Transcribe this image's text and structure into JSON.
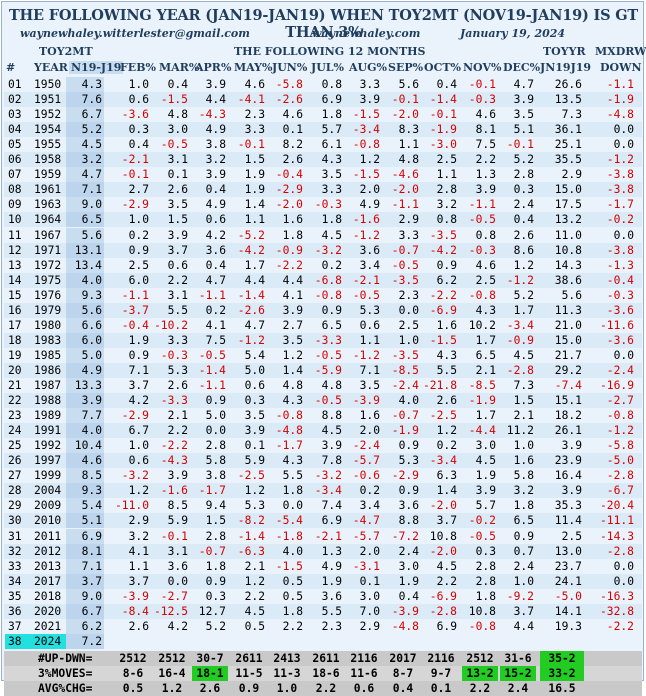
{
  "title": "THE FOLLOWING YEAR (JAN19-JAN19) WHEN TOY2MT (NOV19-JAN19) IS GT THAN 3%",
  "email": "waynewhaley.witterlester@gmail.com",
  "site": "waynewhaley.com",
  "date": "January 19, 2024",
  "group_toy2mt": "TOY2MT",
  "group_following": "THE FOLLOWING 12 MONTHS",
  "group_toyyr": "TOYYR",
  "group_mxdrw": "MXDRW",
  "columns": [
    "#",
    "YEAR",
    "N19-J19",
    "FEB%",
    "MAR%",
    "APR%",
    "MAY%",
    "JUN%",
    "JUL%",
    "AUG%",
    "SEP%",
    "OCT%",
    "NOV%",
    "DEC%",
    "JN19J19",
    "DOWN"
  ],
  "rows": [
    [
      "01",
      "1950",
      "4.3",
      "1.0",
      "0.4",
      "3.9",
      "4.6",
      "-5.8",
      "0.8",
      "3.3",
      "5.6",
      "0.4",
      "-0.1",
      "4.7",
      "26.6",
      "-1.1"
    ],
    [
      "02",
      "1951",
      "7.6",
      "0.6",
      "-1.5",
      "4.4",
      "-4.1",
      "-2.6",
      "6.9",
      "3.9",
      "-0.1",
      "-1.4",
      "-0.3",
      "3.9",
      "13.5",
      "-1.9"
    ],
    [
      "03",
      "1952",
      "6.7",
      "-3.6",
      "4.8",
      "-4.3",
      "2.3",
      "4.6",
      "1.8",
      "-1.5",
      "-2.0",
      "-0.1",
      "4.6",
      "3.5",
      "7.3",
      "-4.8"
    ],
    [
      "04",
      "1954",
      "5.2",
      "0.3",
      "3.0",
      "4.9",
      "3.3",
      "0.1",
      "5.7",
      "-3.4",
      "8.3",
      "-1.9",
      "8.1",
      "5.1",
      "36.1",
      "0.0"
    ],
    [
      "05",
      "1955",
      "4.5",
      "0.4",
      "-0.5",
      "3.8",
      "-0.1",
      "8.2",
      "6.1",
      "-0.8",
      "1.1",
      "-3.0",
      "7.5",
      "-0.1",
      "25.1",
      "0.0"
    ],
    [
      "06",
      "1958",
      "3.2",
      "-2.1",
      "3.1",
      "3.2",
      "1.5",
      "2.6",
      "4.3",
      "1.2",
      "4.8",
      "2.5",
      "2.2",
      "5.2",
      "35.5",
      "-1.2"
    ],
    [
      "07",
      "1959",
      "4.7",
      "-0.1",
      "0.1",
      "3.9",
      "1.9",
      "-0.4",
      "3.5",
      "-1.5",
      "-4.6",
      "1.1",
      "1.3",
      "2.8",
      "2.9",
      "-3.8"
    ],
    [
      "08",
      "1961",
      "7.1",
      "2.7",
      "2.6",
      "0.4",
      "1.9",
      "-2.9",
      "3.3",
      "2.0",
      "-2.0",
      "2.8",
      "3.9",
      "0.3",
      "15.0",
      "-3.8"
    ],
    [
      "09",
      "1963",
      "9.0",
      "-2.9",
      "3.5",
      "4.9",
      "1.4",
      "-2.0",
      "-0.3",
      "4.9",
      "-1.1",
      "3.2",
      "-1.1",
      "2.4",
      "17.5",
      "-1.7"
    ],
    [
      "10",
      "1964",
      "6.5",
      "1.0",
      "1.5",
      "0.6",
      "1.1",
      "1.6",
      "1.8",
      "-1.6",
      "2.9",
      "0.8",
      "-0.5",
      "0.4",
      "13.2",
      "-0.2"
    ],
    [
      "11",
      "1967",
      "5.6",
      "0.2",
      "3.9",
      "4.2",
      "-5.2",
      "1.8",
      "4.5",
      "-1.2",
      "3.3",
      "-3.5",
      "0.8",
      "2.6",
      "11.0",
      "0.0"
    ],
    [
      "12",
      "1971",
      "13.1",
      "0.9",
      "3.7",
      "3.6",
      "-4.2",
      "-0.9",
      "-3.2",
      "3.6",
      "-0.7",
      "-4.2",
      "-0.3",
      "8.6",
      "10.8",
      "-3.8"
    ],
    [
      "13",
      "1972",
      "13.4",
      "2.5",
      "0.6",
      "0.4",
      "1.7",
      "-2.2",
      "0.2",
      "3.4",
      "-0.5",
      "0.9",
      "4.6",
      "1.2",
      "14.3",
      "-1.3"
    ],
    [
      "14",
      "1975",
      "4.0",
      "6.0",
      "2.2",
      "4.7",
      "4.4",
      "4.4",
      "-6.8",
      "-2.1",
      "-3.5",
      "6.2",
      "2.5",
      "-1.2",
      "38.6",
      "-0.4"
    ],
    [
      "15",
      "1976",
      "9.3",
      "-1.1",
      "3.1",
      "-1.1",
      "-1.4",
      "4.1",
      "-0.8",
      "-0.5",
      "2.3",
      "-2.2",
      "-0.8",
      "5.2",
      "5.6",
      "-0.3"
    ],
    [
      "16",
      "1979",
      "5.6",
      "-3.7",
      "5.5",
      "0.2",
      "-2.6",
      "3.9",
      "0.9",
      "5.3",
      "0.0",
      "-6.9",
      "4.3",
      "1.7",
      "11.3",
      "-3.6"
    ],
    [
      "17",
      "1980",
      "6.6",
      "-0.4",
      "-10.2",
      "4.1",
      "4.7",
      "2.7",
      "6.5",
      "0.6",
      "2.5",
      "1.6",
      "10.2",
      "-3.4",
      "21.0",
      "-11.6"
    ],
    [
      "18",
      "1983",
      "6.0",
      "1.9",
      "3.3",
      "7.5",
      "-1.2",
      "3.5",
      "-3.3",
      "1.1",
      "1.0",
      "-1.5",
      "1.7",
      "-0.9",
      "15.0",
      "-3.6"
    ],
    [
      "19",
      "1985",
      "5.0",
      "0.9",
      "-0.3",
      "-0.5",
      "5.4",
      "1.2",
      "-0.5",
      "-1.2",
      "-3.5",
      "4.3",
      "6.5",
      "4.5",
      "21.7",
      "0.0"
    ],
    [
      "20",
      "1986",
      "4.9",
      "7.1",
      "5.3",
      "-1.4",
      "5.0",
      "1.4",
      "-5.9",
      "7.1",
      "-8.5",
      "5.5",
      "2.1",
      "-2.8",
      "29.2",
      "-2.4"
    ],
    [
      "21",
      "1987",
      "13.3",
      "3.7",
      "2.6",
      "-1.1",
      "0.6",
      "4.8",
      "4.8",
      "3.5",
      "-2.4",
      "-21.8",
      "-8.5",
      "7.3",
      "-7.4",
      "-16.9"
    ],
    [
      "22",
      "1988",
      "3.9",
      "4.2",
      "-3.3",
      "0.9",
      "0.3",
      "4.3",
      "-0.5",
      "-3.9",
      "4.0",
      "2.6",
      "-1.9",
      "1.5",
      "15.1",
      "-2.7"
    ],
    [
      "23",
      "1989",
      "7.7",
      "-2.9",
      "2.1",
      "5.0",
      "3.5",
      "-0.8",
      "8.8",
      "1.6",
      "-0.7",
      "-2.5",
      "1.7",
      "2.1",
      "18.2",
      "-0.8"
    ],
    [
      "24",
      "1991",
      "4.0",
      "6.7",
      "2.2",
      "0.0",
      "3.9",
      "-4.8",
      "4.5",
      "2.0",
      "-1.9",
      "1.2",
      "-4.4",
      "11.2",
      "26.1",
      "-1.2"
    ],
    [
      "25",
      "1992",
      "10.4",
      "1.0",
      "-2.2",
      "2.8",
      "0.1",
      "-1.7",
      "3.9",
      "-2.4",
      "0.9",
      "0.2",
      "3.0",
      "1.0",
      "3.9",
      "-5.8"
    ],
    [
      "26",
      "1997",
      "4.6",
      "0.6",
      "-4.3",
      "5.8",
      "5.9",
      "4.3",
      "7.8",
      "-5.7",
      "5.3",
      "-3.4",
      "4.5",
      "1.6",
      "23.9",
      "-5.0"
    ],
    [
      "27",
      "1999",
      "8.5",
      "-3.2",
      "3.9",
      "3.8",
      "-2.5",
      "5.5",
      "-3.2",
      "-0.6",
      "-2.9",
      "6.3",
      "1.9",
      "5.8",
      "16.4",
      "-2.8"
    ],
    [
      "28",
      "2004",
      "9.3",
      "1.2",
      "-1.6",
      "-1.7",
      "1.2",
      "1.8",
      "-3.4",
      "0.2",
      "0.9",
      "1.4",
      "3.9",
      "3.2",
      "3.9",
      "-6.7"
    ],
    [
      "29",
      "2009",
      "5.4",
      "-11.0",
      "8.5",
      "9.4",
      "5.3",
      "0.0",
      "7.4",
      "3.4",
      "3.6",
      "-2.0",
      "5.7",
      "1.8",
      "35.3",
      "-20.4"
    ],
    [
      "30",
      "2010",
      "5.1",
      "2.9",
      "5.9",
      "1.5",
      "-8.2",
      "-5.4",
      "6.9",
      "-4.7",
      "8.8",
      "3.7",
      "-0.2",
      "6.5",
      "11.4",
      "-11.1"
    ],
    [
      "31",
      "2011",
      "6.9",
      "3.2",
      "-0.1",
      "2.8",
      "-1.4",
      "-1.8",
      "-2.1",
      "-5.7",
      "-7.2",
      "10.8",
      "-0.5",
      "0.9",
      "2.5",
      "-14.3"
    ],
    [
      "32",
      "2012",
      "8.1",
      "4.1",
      "3.1",
      "-0.7",
      "-6.3",
      "4.0",
      "1.3",
      "2.0",
      "2.4",
      "-2.0",
      "0.3",
      "0.7",
      "13.0",
      "-2.8"
    ],
    [
      "33",
      "2013",
      "7.1",
      "1.1",
      "3.6",
      "1.8",
      "2.1",
      "-1.5",
      "4.9",
      "-3.1",
      "3.0",
      "4.5",
      "2.8",
      "2.4",
      "23.7",
      "0.0"
    ],
    [
      "34",
      "2017",
      "3.7",
      "3.7",
      "0.0",
      "0.9",
      "1.2",
      "0.5",
      "1.9",
      "0.1",
      "1.9",
      "2.2",
      "2.8",
      "1.0",
      "24.1",
      "0.0"
    ],
    [
      "35",
      "2018",
      "9.0",
      "-3.9",
      "-2.7",
      "0.3",
      "2.2",
      "0.5",
      "3.6",
      "3.0",
      "0.4",
      "-6.9",
      "1.8",
      "-9.2",
      "-5.0",
      "-16.3"
    ],
    [
      "36",
      "2020",
      "6.7",
      "-8.4",
      "-12.5",
      "12.7",
      "4.5",
      "1.8",
      "5.5",
      "7.0",
      "-3.9",
      "-2.8",
      "10.8",
      "3.7",
      "14.1",
      "-32.8"
    ],
    [
      "37",
      "2021",
      "6.2",
      "2.6",
      "4.2",
      "5.2",
      "0.5",
      "2.2",
      "2.3",
      "2.9",
      "-4.8",
      "6.9",
      "-0.8",
      "4.4",
      "19.3",
      "-2.2"
    ],
    [
      "38",
      "2024",
      "7.2",
      "",
      "",
      "",
      "",
      "",
      "",
      "",
      "",
      "",
      "",
      "",
      "",
      ""
    ]
  ],
  "footer": {
    "up_label": "#UP-DWN=",
    "up": [
      "2512",
      "2512",
      "30-7",
      "2611",
      "2413",
      "2611",
      "2116",
      "2017",
      "2116",
      "2512",
      "31-6",
      "35-2"
    ],
    "moves_label": "3%MOVES=",
    "moves": [
      "8-6",
      "16-4",
      "18-1",
      "11-5",
      "11-3",
      "18-6",
      "11-6",
      "8-7",
      "9-7",
      "13-2",
      "15-2",
      "33-2"
    ],
    "avg_label": "AVG%CHG=",
    "avg": [
      "0.5",
      "1.2",
      "2.6",
      "0.9",
      "1.0",
      "2.2",
      "0.6",
      "0.4",
      "0.1",
      "2.2",
      "2.4",
      "16.5"
    ]
  },
  "colors": {
    "negative": "#d40000",
    "highlight": "#22cc22",
    "current_row": "#22e0e0"
  }
}
